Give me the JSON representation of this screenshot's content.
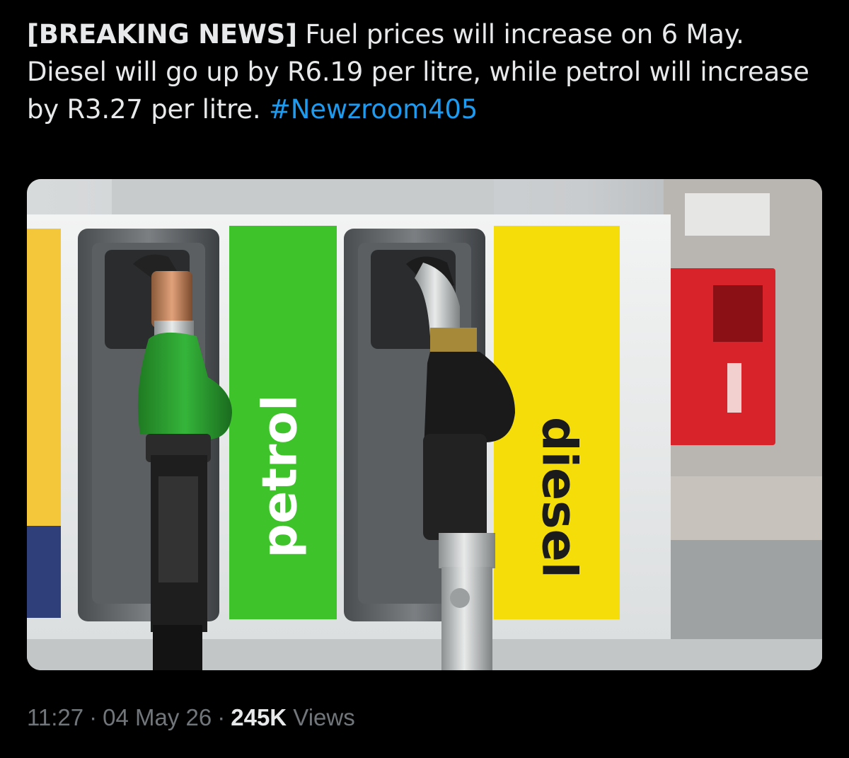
{
  "tweet": {
    "lead": "[BREAKING NEWS]",
    "body": " Fuel prices will increase on 6 May. Diesel will go up by R6.19 per litre, while petrol will increase by R3.27 per litre. ",
    "hashtag": "#Newzroom405",
    "accent_color": "#1d9bf0"
  },
  "media": {
    "petrol_label": "petrol",
    "diesel_label": "diesel",
    "petrol_color": "#3ec42a",
    "diesel_color": "#f5dd0a"
  },
  "meta": {
    "time": "11:27",
    "date": "04 May 26",
    "views_count": "245K",
    "views_label": "Views",
    "separator": "·"
  }
}
